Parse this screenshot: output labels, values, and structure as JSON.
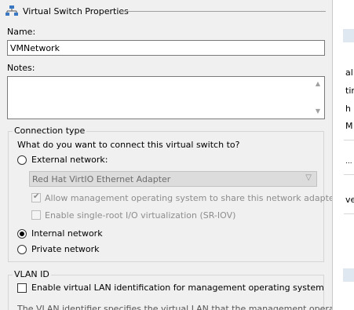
{
  "header": {
    "title": "Virtual Switch Properties"
  },
  "name": {
    "label": "Name:",
    "value": "VMNetwork"
  },
  "notes": {
    "label": "Notes:",
    "value": ""
  },
  "connection": {
    "title": "Connection type",
    "question": "What do you want to connect this virtual switch to?",
    "external_label": "External network:",
    "adapter_value": "Red Hat VirtIO Ethernet Adapter",
    "allow_mgmt_label": "Allow management operating system to share this network adapter",
    "allow_mgmt_checked": true,
    "sriov_label": "Enable single-root I/O virtualization (SR-IOV)",
    "sriov_checked": false,
    "internal_label": "Internal network",
    "private_label": "Private network",
    "selected": "internal"
  },
  "vlan": {
    "title": "VLAN ID",
    "enable_label": "Enable virtual LAN identification for management operating system",
    "enable_checked": false,
    "help_text": "The VLAN identifier specifies the virtual LAN that the management operating"
  },
  "right_panel": {
    "fragments": [
      "al",
      "tir",
      "h",
      "M",
      "...",
      "ve"
    ]
  }
}
